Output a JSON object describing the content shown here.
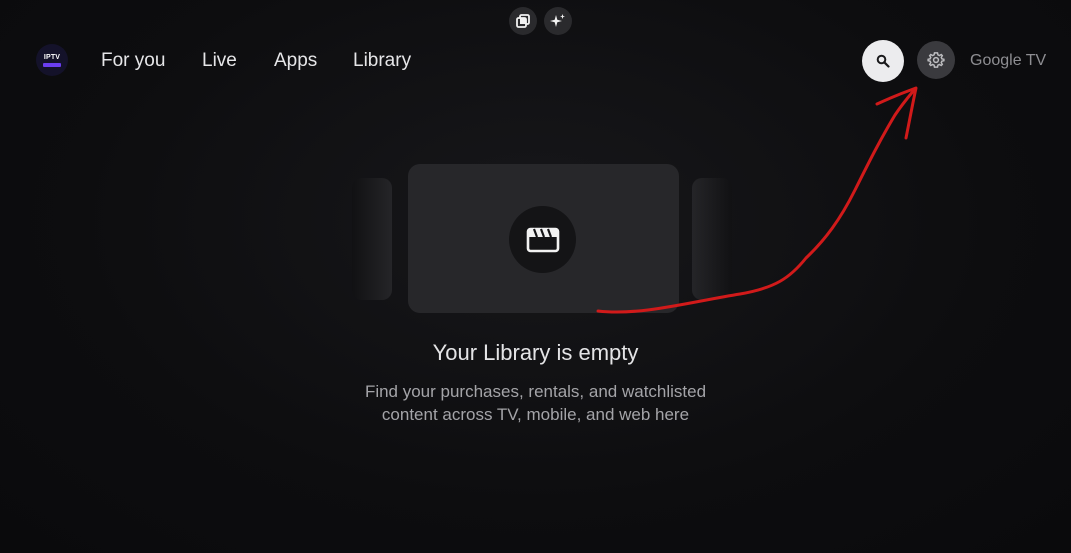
{
  "top_buttons": {
    "copy_icon": "copy-icon",
    "sparkle_icon": "sparkle-icon"
  },
  "nav": {
    "logo_text": "IPTV",
    "tabs": [
      {
        "label": "For you"
      },
      {
        "label": "Live"
      },
      {
        "label": "Apps"
      },
      {
        "label": "Library"
      }
    ],
    "search_icon": "search-icon",
    "settings_icon": "gear-icon",
    "brand": "Google TV"
  },
  "library": {
    "illustration_icon": "clapperboard-icon",
    "title": "Your Library is empty",
    "description_line1": "Find your purchases, rentals, and watchlisted",
    "description_line2": "content across TV, mobile, and web here"
  },
  "annotation": {
    "color": "#d11a1a"
  },
  "colors": {
    "background": "#0e0e10",
    "search_bg": "#ececee",
    "settings_bg": "#3a3a3e"
  }
}
